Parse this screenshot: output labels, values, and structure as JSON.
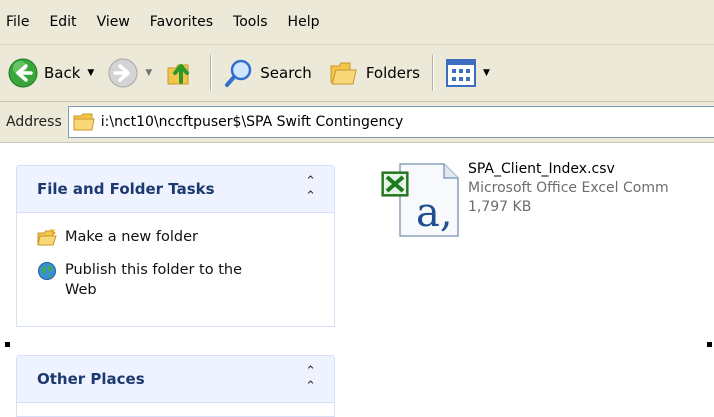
{
  "menu": [
    "File",
    "Edit",
    "View",
    "Favorites",
    "Tools",
    "Help"
  ],
  "toolbar": {
    "back_label": "Back",
    "search_label": "Search",
    "folders_label": "Folders"
  },
  "address": {
    "label": "Address",
    "path": "i:\\nct10\\nccftpuser$\\SPA Swift Contingency"
  },
  "tasks_pane": {
    "title": "File and Folder Tasks",
    "items": [
      {
        "label": "Make a new folder",
        "icon": "new-folder-icon"
      },
      {
        "label": "Publish this folder to the Web",
        "icon": "globe-icon"
      }
    ]
  },
  "other_places": {
    "title": "Other Places"
  },
  "file": {
    "name": "SPA_Client_Index.csv",
    "type": "Microsoft Office Excel Comm",
    "size": "1,797 KB"
  },
  "colors": {
    "chrome": "#ece9d8",
    "pane_header": "#eef3ff",
    "back_green": "#3aa53a",
    "excel_green": "#1d7a1d"
  }
}
